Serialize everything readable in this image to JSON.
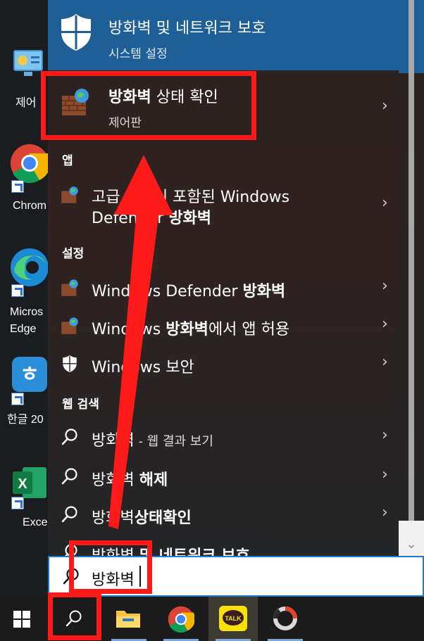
{
  "desktop": {
    "icons": [
      {
        "label": "제어",
        "icon": "control-panel-icon"
      },
      {
        "label": "Chrom",
        "icon": "chrome-icon"
      },
      {
        "label": "Micros\nEdge",
        "icon": "edge-icon"
      },
      {
        "label": "한글 20",
        "icon": "hangul-icon"
      },
      {
        "label": "Exce",
        "icon": "excel-icon"
      }
    ]
  },
  "best_match": {
    "title": "방화벽 및 네트워크 보호",
    "subtitle": "시스템 설정",
    "icon": "shield-icon"
  },
  "firewall_status": {
    "title_bold": "방화벽",
    "title_rest": " 상태 확인",
    "subtitle": "제어판",
    "icon": "firewall-icon"
  },
  "sections": {
    "apps": "앱",
    "settings": "설정",
    "web": "웹 검색"
  },
  "apps": [
    {
      "line1": "고급 보안이 포함된 Windows",
      "line2_pre": "Defender ",
      "line2_bold": "방화벽"
    }
  ],
  "settings": [
    {
      "pre": "Windows Defender ",
      "bold": "방화벽",
      "post": ""
    },
    {
      "pre": "Windows ",
      "bold": "방화벽",
      "post": "에서 앱 허용"
    },
    {
      "pre": "Windows 보안",
      "bold": "",
      "post": ""
    }
  ],
  "web": [
    {
      "pre": "방화벽",
      "bold": "",
      "post": " - 웹 결과 보기"
    },
    {
      "pre": "방화벽 ",
      "bold": "해제",
      "post": ""
    },
    {
      "pre": "방화벽",
      "bold": "상태확인",
      "post": ""
    },
    {
      "pre": "방화벽 ",
      "bold": "및 네트워크 보호",
      "post": ""
    }
  ],
  "search": {
    "value": "방화벽"
  },
  "taskbar": {
    "items": [
      "windows-start-icon",
      "search-icon",
      "file-explorer-icon",
      "chrome-icon",
      "kakaotalk-icon",
      "app-icon"
    ],
    "kakao_label": "TALK"
  },
  "colors": {
    "accent": "#1e5f97",
    "annotation": "#ff1a1a"
  }
}
